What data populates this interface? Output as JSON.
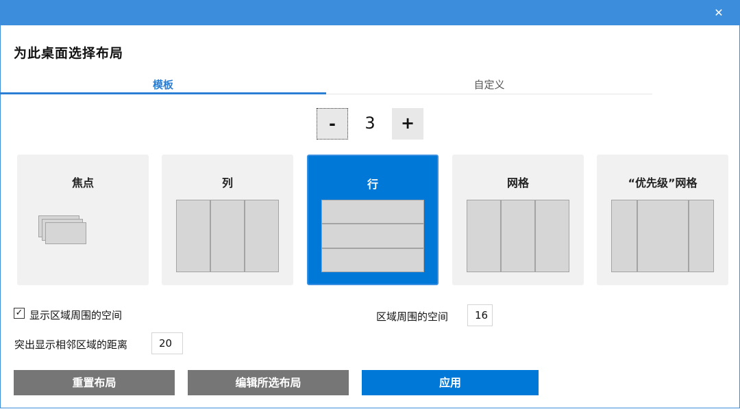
{
  "window": {
    "close_glyph": "✕"
  },
  "heading": "为此桌面选择布局",
  "tabs": [
    {
      "label": "模板",
      "active": true
    },
    {
      "label": "自定义",
      "active": false
    }
  ],
  "stepper": {
    "minus": "-",
    "value": "3",
    "plus": "+"
  },
  "templates": [
    {
      "title": "焦点",
      "selected": false
    },
    {
      "title": "列",
      "selected": false
    },
    {
      "title": "行",
      "selected": true
    },
    {
      "title": "网格",
      "selected": false
    },
    {
      "title": "“优先级”网格",
      "selected": false
    }
  ],
  "options": {
    "show_space": {
      "label": "显示区域周围的空间",
      "checked": true,
      "check_glyph": "✓"
    },
    "space_around": {
      "label": "区域周围的空间",
      "value": "16"
    },
    "highlight_distance": {
      "label": "突出显示相邻区域的距离",
      "value": "20"
    }
  },
  "buttons": {
    "reset": "重置布局",
    "edit": "编辑所选布局",
    "apply": "应用"
  },
  "colors": {
    "titlebar": "#3c8ddc",
    "accent": "#0078d7",
    "gray_button": "#767676"
  }
}
